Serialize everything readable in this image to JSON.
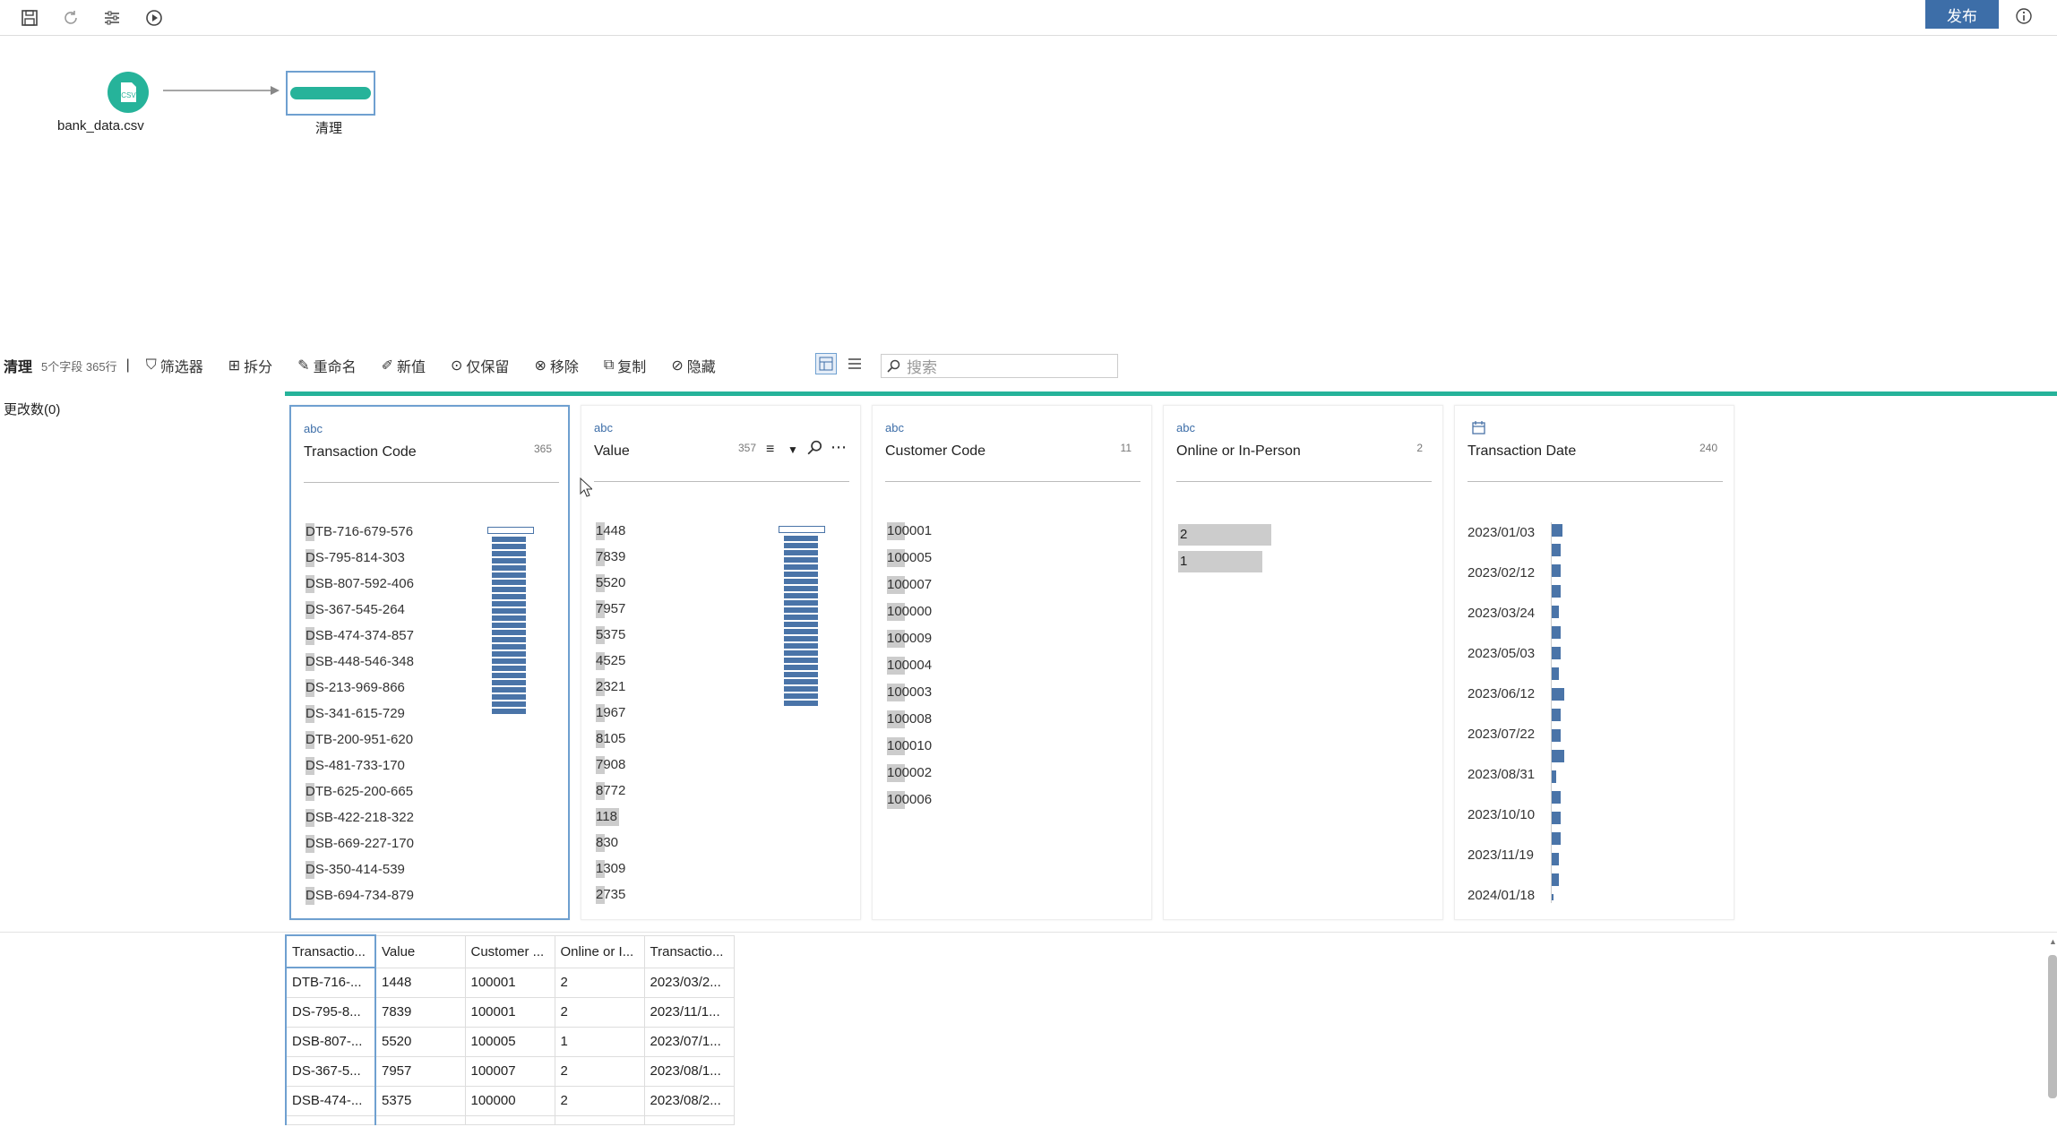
{
  "toolbar": {
    "publish_label": "发布"
  },
  "flow": {
    "source_node_label": "bank_data.csv",
    "source_icon_text": "CSV",
    "clean_node_label": "清理"
  },
  "step": {
    "name": "清理",
    "meta": "5个字段 365行",
    "separator": "|",
    "tools": [
      "筛选器",
      "拆分",
      "重命名",
      "新值",
      "仅保留",
      "移除",
      "复制",
      "隐藏"
    ],
    "search_placeholder": "搜索",
    "changes_label": "更改数(0)"
  },
  "cards": [
    {
      "type": "abc",
      "name": "Transaction Code",
      "count": "365",
      "values": [
        "DTB-716-679-576",
        "DS-795-814-303",
        "DSB-807-592-406",
        "DS-367-545-264",
        "DSB-474-374-857",
        "DSB-448-546-348",
        "DS-213-969-866",
        "DS-341-615-729",
        "DTB-200-951-620",
        "DS-481-733-170",
        "DTB-625-200-665",
        "DSB-422-218-322",
        "DSB-669-227-170",
        "DS-350-414-539",
        "DSB-694-734-879"
      ]
    },
    {
      "type": "abc",
      "name": "Value",
      "count": "357",
      "values": [
        "1448",
        "7839",
        "5520",
        "7957",
        "5375",
        "4525",
        "2321",
        "1967",
        "8105",
        "7908",
        "8772",
        "118",
        "830",
        "1309",
        "2735"
      ]
    },
    {
      "type": "abc",
      "name": "Customer Code",
      "count": "11",
      "values": [
        "100001",
        "100005",
        "100007",
        "100000",
        "100009",
        "100004",
        "100003",
        "100008",
        "100010",
        "100002",
        "100006"
      ],
      "bar_fraction": [
        0.1,
        0.1,
        0.1,
        0.1,
        0.1,
        0.1,
        0.1,
        0.1,
        0.1,
        0.1,
        0.1
      ]
    },
    {
      "type": "abc",
      "name": "Online or In-Person",
      "count": "2",
      "values": [
        "2",
        "1"
      ],
      "bar_fraction": [
        1.0,
        0.9
      ]
    },
    {
      "type": "date",
      "name": "Transaction Date",
      "count": "240",
      "ticks": [
        "2023/01/03",
        "2023/02/12",
        "2023/03/24",
        "2023/05/03",
        "2023/06/12",
        "2023/07/22",
        "2023/08/31",
        "2023/10/10",
        "2023/11/19",
        "2024/01/18"
      ]
    }
  ],
  "table": {
    "headers": [
      "Transactio...",
      "Value",
      "Customer ...",
      "Online or I...",
      "Transactio..."
    ],
    "rows": [
      [
        "DTB-716-...",
        "1448",
        "100001",
        "2",
        "2023/03/2..."
      ],
      [
        "DS-795-8...",
        "7839",
        "100001",
        "2",
        "2023/11/1..."
      ],
      [
        "DSB-807-...",
        "5520",
        "100005",
        "1",
        "2023/07/1..."
      ],
      [
        "DS-367-5...",
        "7957",
        "100007",
        "2",
        "2023/08/1..."
      ],
      [
        "DSB-474-...",
        "5375",
        "100000",
        "2",
        "2023/08/2..."
      ],
      [
        "",
        "",
        "",
        "",
        ""
      ]
    ]
  }
}
